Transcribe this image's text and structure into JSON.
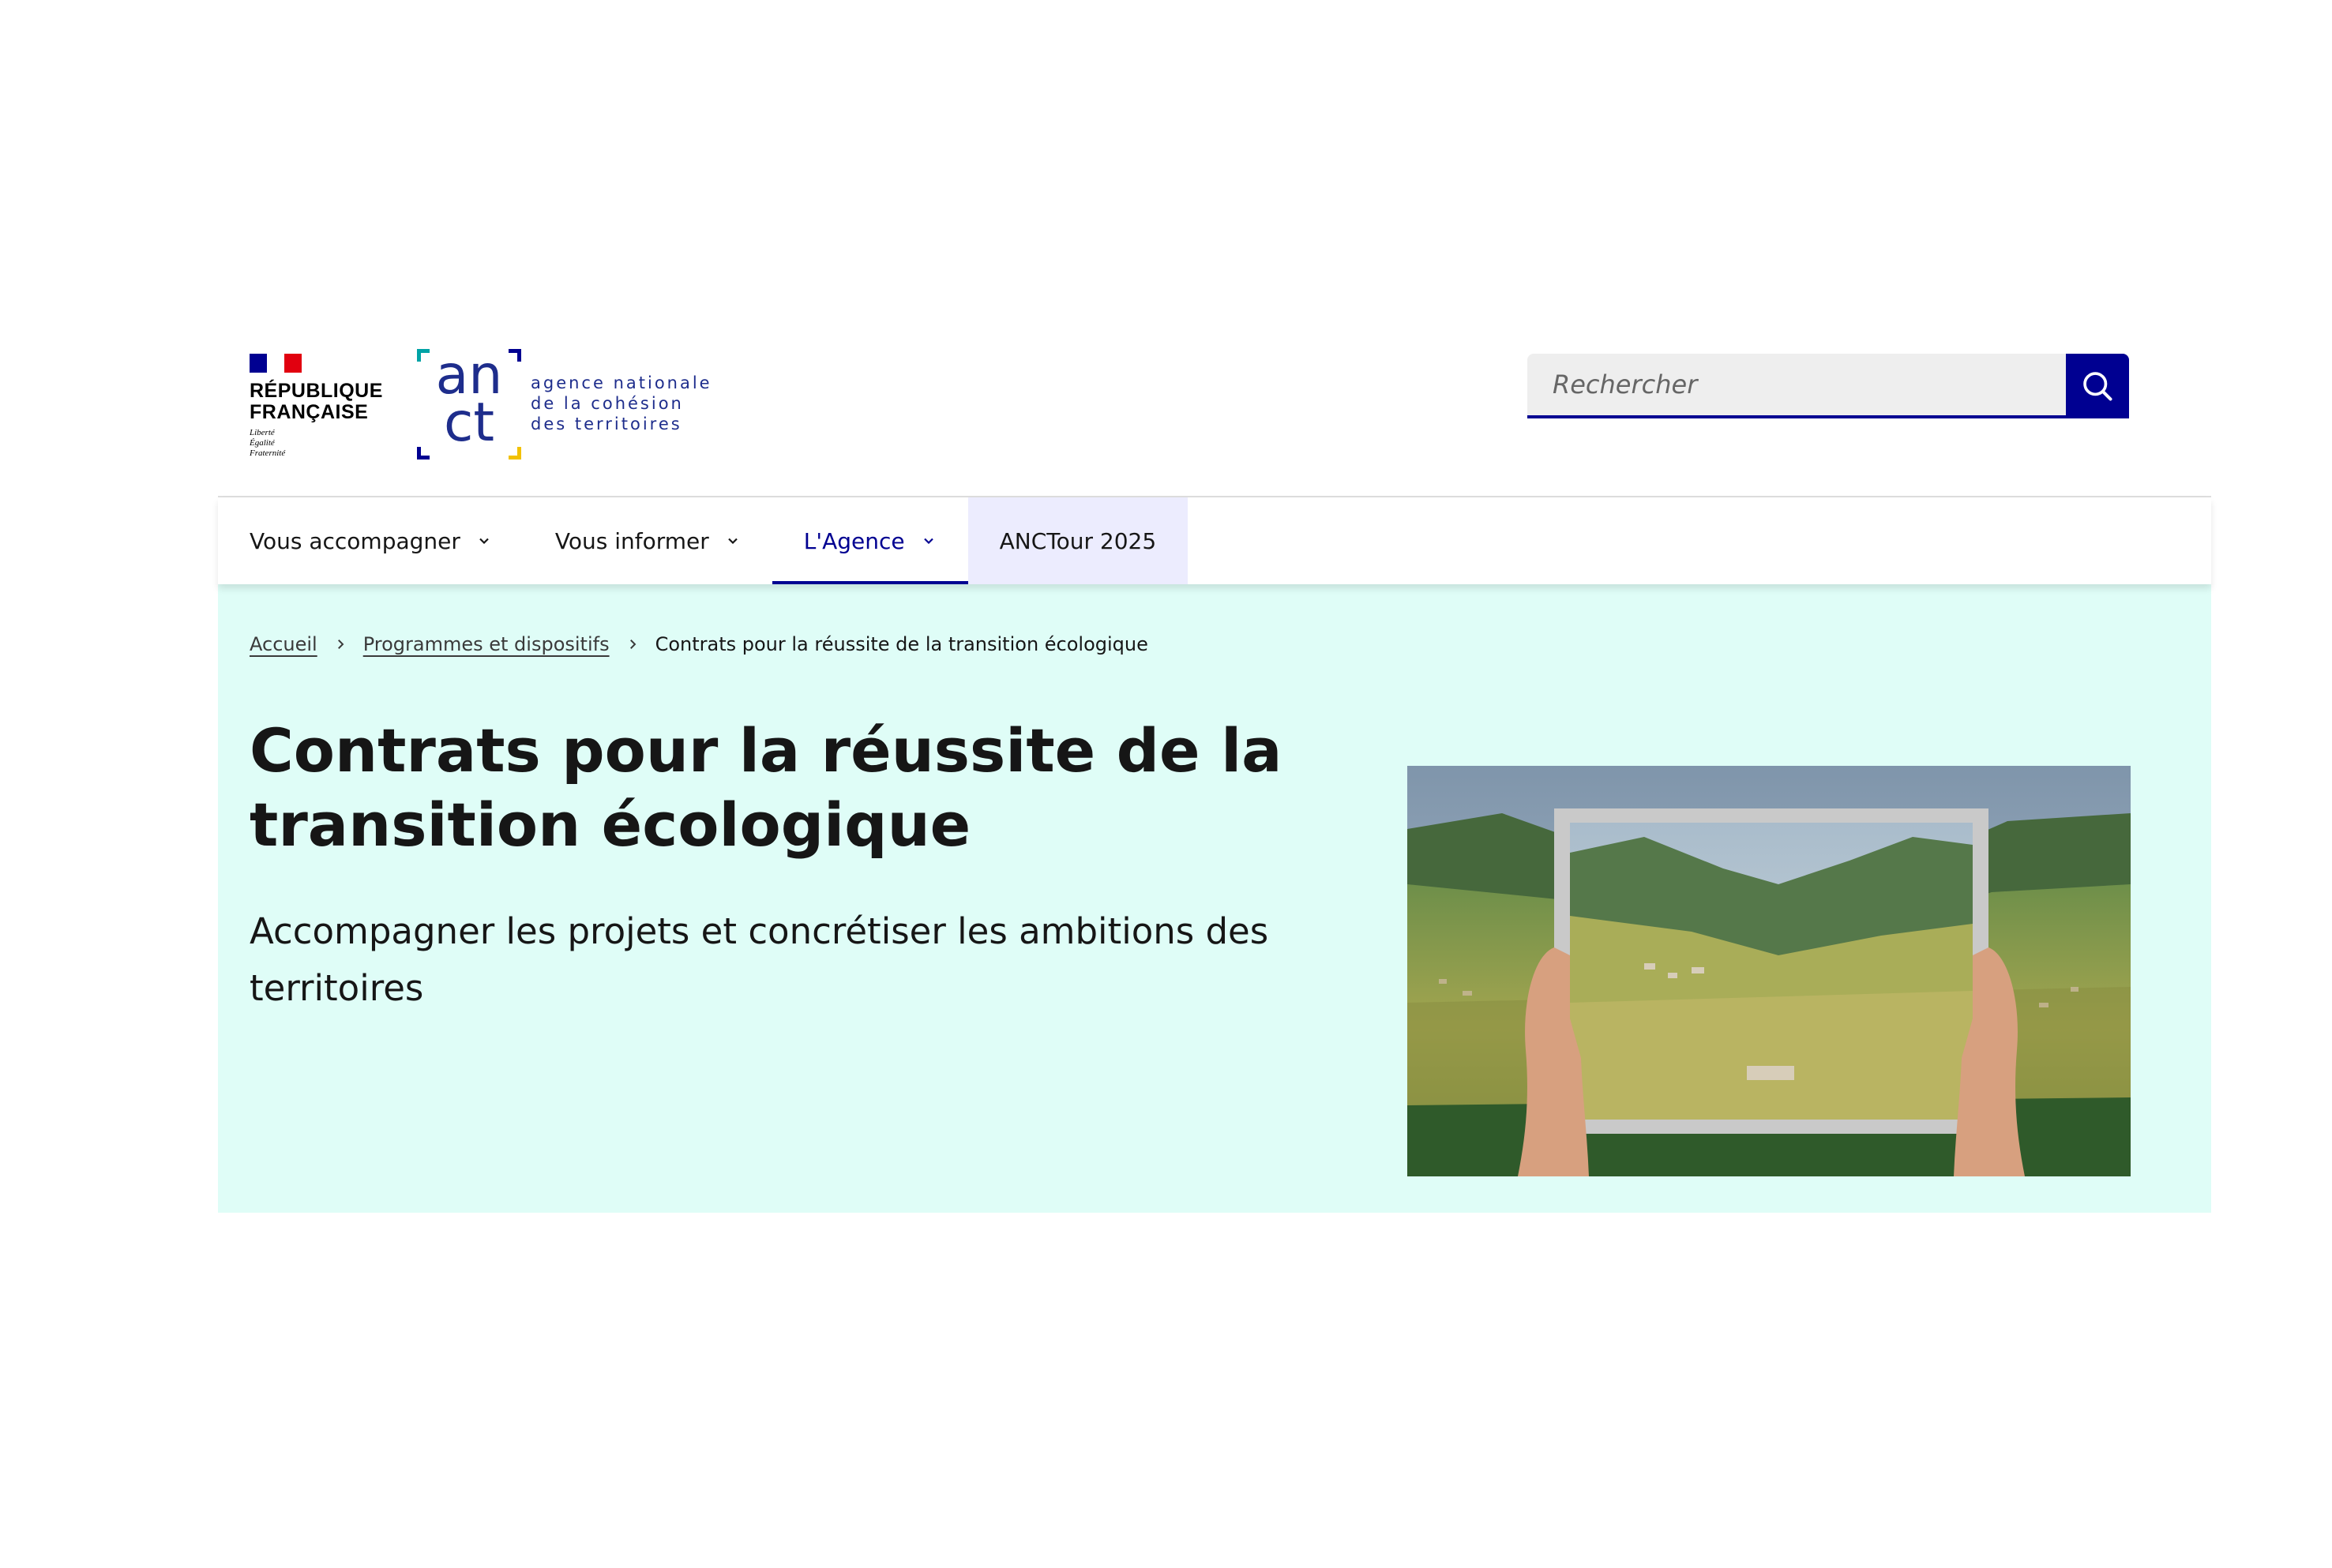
{
  "header": {
    "republique": {
      "title": "RÉPUBLIQUE\nFRANÇAISE",
      "motto": "Liberté\nÉgalité\nFraternité"
    },
    "logo": {
      "line1": "an",
      "line2": "ct",
      "name": "agence nationale\nde la cohésion\ndes territoires"
    },
    "search": {
      "placeholder": "Rechercher",
      "value": ""
    }
  },
  "nav": {
    "items": [
      {
        "label": "Vous accompagner",
        "has_dropdown": true,
        "state": "default"
      },
      {
        "label": "Vous informer",
        "has_dropdown": true,
        "state": "default"
      },
      {
        "label": "L'Agence",
        "has_dropdown": true,
        "state": "active"
      },
      {
        "label": "ANCTour 2025",
        "has_dropdown": false,
        "state": "highlight"
      }
    ]
  },
  "breadcrumb": {
    "items": [
      {
        "label": "Accueil",
        "link": true
      },
      {
        "label": "Programmes et dispositifs",
        "link": true
      },
      {
        "label": "Contrats pour la réussite de la transition écologique",
        "link": false
      }
    ]
  },
  "hero": {
    "title": "Contrats pour la réussite de la transition écologique",
    "lead": "Accompagner les projets et concrétiser les ambitions des territoires"
  },
  "icons": {
    "search": "search-icon",
    "dropdown": "chevron-down-icon",
    "breadcrumb_separator": "chevron-right-icon"
  },
  "colors": {
    "primary_blue": "#000091",
    "hero_background": "#dffdf7",
    "nav_highlight": "#ececfe",
    "flag_blue": "#000091",
    "flag_red": "#e1000f",
    "logo_blue": "#1e2d8c",
    "logo_teal": "#00a3a6",
    "logo_yellow": "#f2c100"
  }
}
